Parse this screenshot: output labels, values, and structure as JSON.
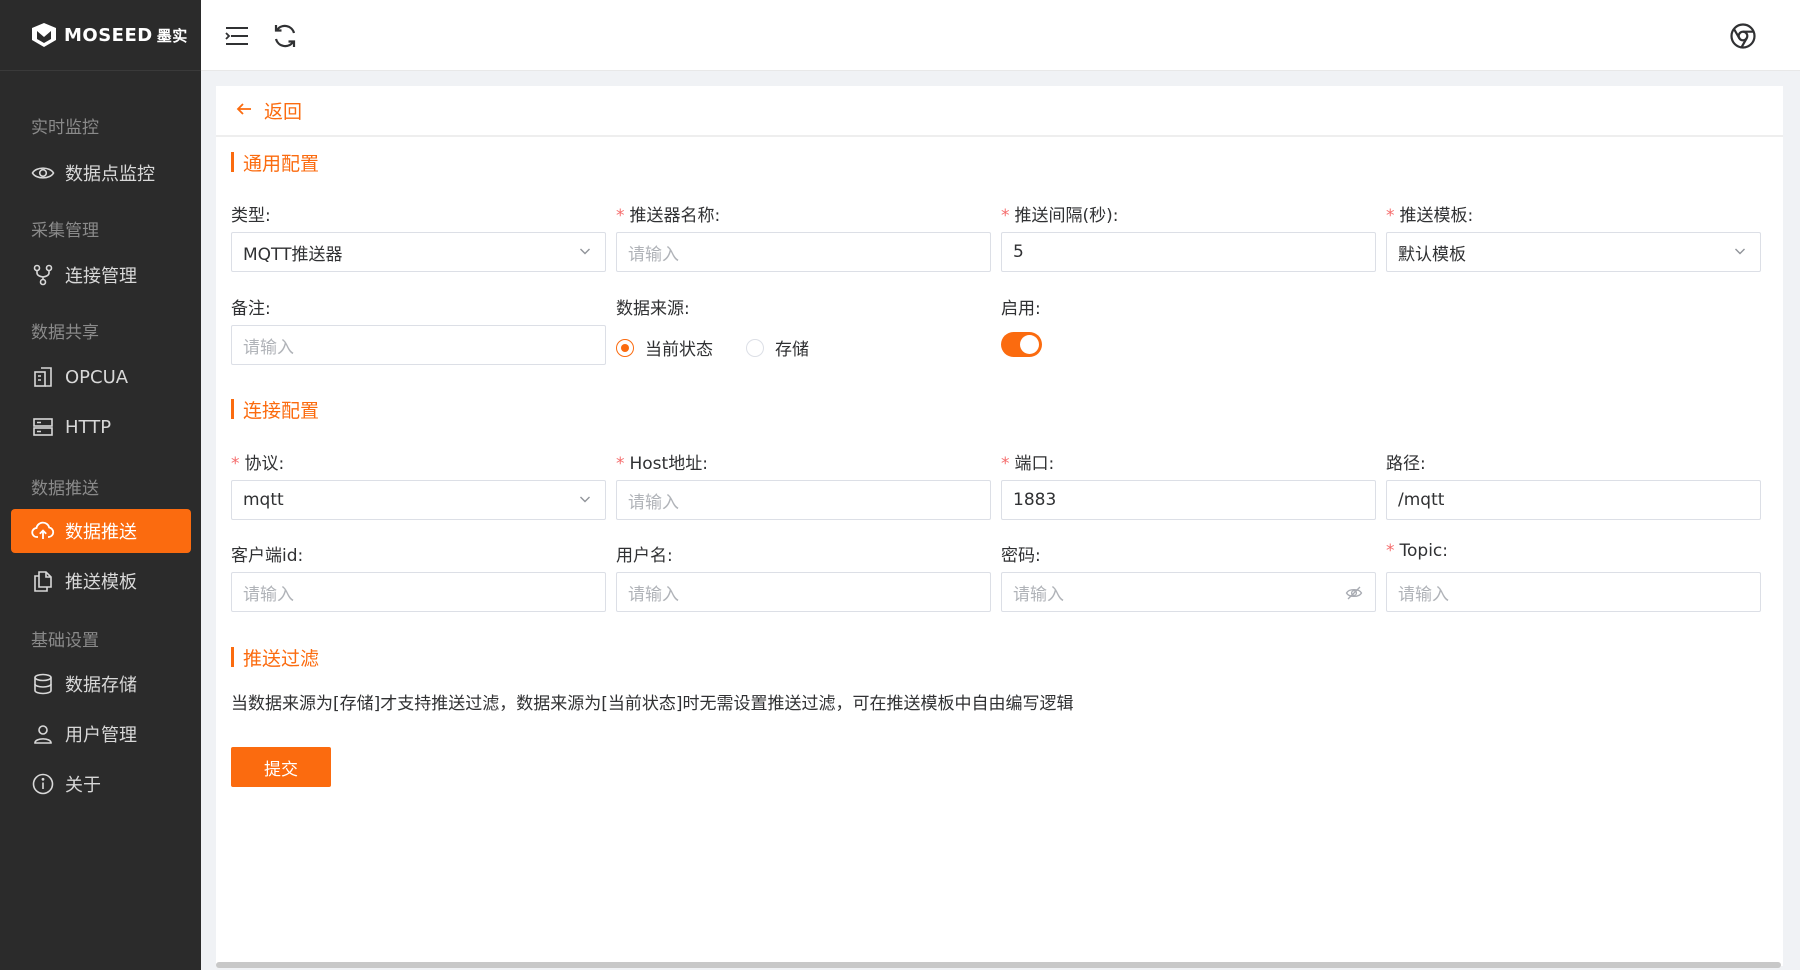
{
  "brand": {
    "name": "MOSEED",
    "name_cn": "墨实"
  },
  "sidebar": {
    "groups": [
      {
        "title": "实时监控",
        "items": [
          {
            "label": "数据点监控",
            "icon": "eye-icon"
          }
        ]
      },
      {
        "title": "采集管理",
        "items": [
          {
            "label": "连接管理",
            "icon": "branch-icon"
          }
        ]
      },
      {
        "title": "数据共享",
        "items": [
          {
            "label": "OPCUA",
            "icon": "building-icon"
          },
          {
            "label": "HTTP",
            "icon": "server-icon"
          }
        ]
      },
      {
        "title": "数据推送",
        "items": [
          {
            "label": "数据推送",
            "icon": "cloud-upload-icon",
            "active": true
          },
          {
            "label": "推送模板",
            "icon": "copy-icon"
          }
        ]
      },
      {
        "title": "基础设置",
        "items": [
          {
            "label": "数据存储",
            "icon": "database-icon"
          },
          {
            "label": "用户管理",
            "icon": "user-icon"
          },
          {
            "label": "关于",
            "icon": "info-icon"
          }
        ]
      }
    ]
  },
  "topbar": {
    "menu_icon": "menu-fold-icon",
    "refresh_icon": "refresh-icon",
    "browser_icon": "chrome-icon"
  },
  "page": {
    "back_label": "返回",
    "sections": {
      "general": "通用配置",
      "connection": "连接配置",
      "filter": "推送过滤"
    },
    "general": {
      "type": {
        "label": "类型:",
        "value": "MQTT推送器",
        "required": false
      },
      "name": {
        "label": "推送器名称:",
        "placeholder": "请输入",
        "required": true
      },
      "interval": {
        "label": "推送间隔(秒):",
        "value": "5",
        "required": true
      },
      "template": {
        "label": "推送模板:",
        "value": "默认模板",
        "required": true
      },
      "remark": {
        "label": "备注:",
        "placeholder": "请输入"
      },
      "source": {
        "label": "数据来源:",
        "options": [
          "当前状态",
          "存储"
        ],
        "selected": "当前状态"
      },
      "enabled": {
        "label": "启用:",
        "value": true
      }
    },
    "connection": {
      "protocol": {
        "label": "协议:",
        "value": "mqtt",
        "required": true
      },
      "host": {
        "label": "Host地址:",
        "placeholder": "请输入",
        "required": true
      },
      "port": {
        "label": "端口:",
        "value": "1883",
        "required": true
      },
      "path": {
        "label": "路径:",
        "value": "/mqtt"
      },
      "client_id": {
        "label": "客户端id:",
        "placeholder": "请输入"
      },
      "username": {
        "label": "用户名:",
        "placeholder": "请输入"
      },
      "password": {
        "label": "密码:",
        "placeholder": "请输入"
      },
      "topic": {
        "label": "Topic:",
        "placeholder": "请输入",
        "required": true
      }
    },
    "filter_note": "当数据来源为[存储]才支持推送过滤，数据来源为[当前状态]时无需设置推送过滤，可在推送模板中自由编写逻辑",
    "submit_label": "提交"
  },
  "colors": {
    "accent": "#fb6b0f",
    "sidebar_bg": "#2b2b2b",
    "required": "#f56c6c"
  }
}
